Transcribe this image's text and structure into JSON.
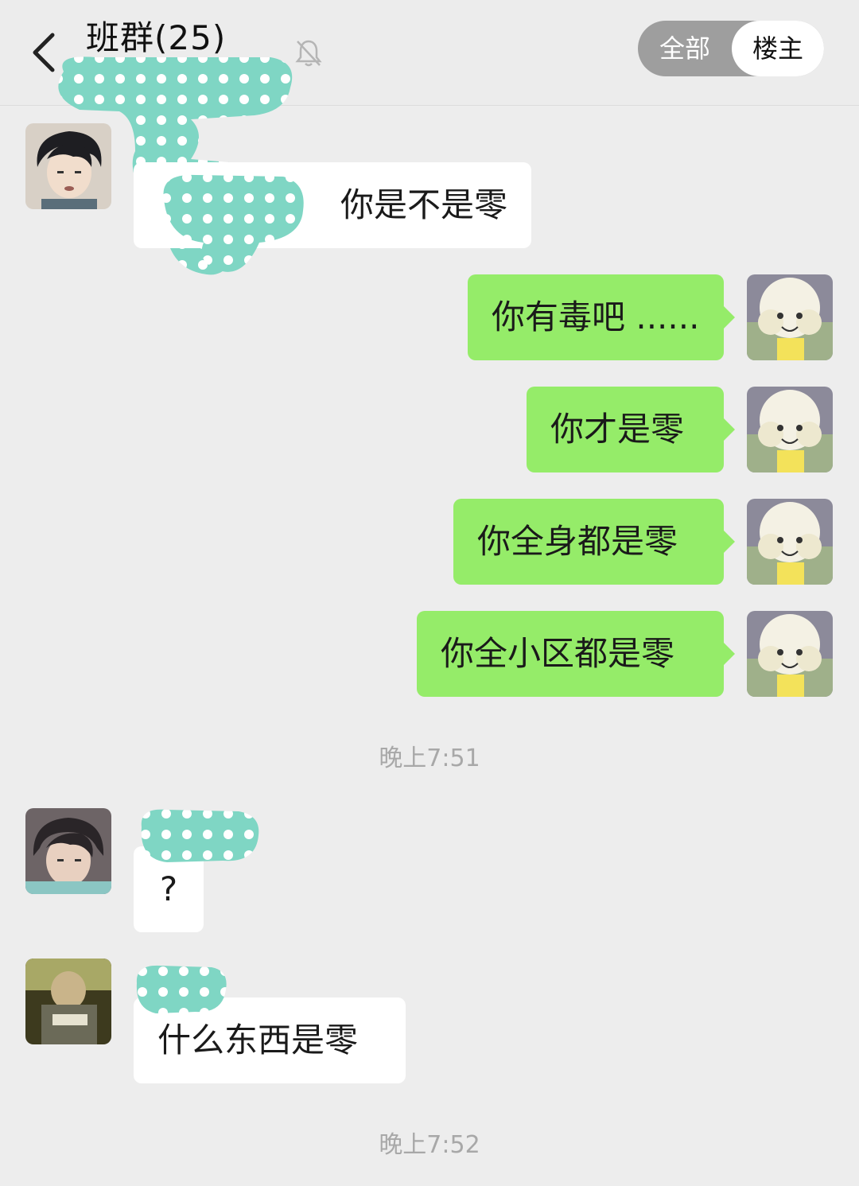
{
  "header": {
    "title": "班群(25)",
    "toggle": {
      "all_label": "全部",
      "host_label": "楼主",
      "selected": "楼主"
    }
  },
  "messages": [
    {
      "side": "left",
      "text": "你是不是零",
      "avatar": "anime-boy-avatar"
    },
    {
      "side": "right",
      "text": "你有毒吧 ......",
      "avatar": "sheep-avatar"
    },
    {
      "side": "right",
      "text": "你才是零",
      "avatar": "sheep-avatar"
    },
    {
      "side": "right",
      "text": "你全身都是零",
      "avatar": "sheep-avatar"
    },
    {
      "side": "right",
      "text": "你全小区都是零",
      "avatar": "sheep-avatar"
    },
    {
      "side": "left",
      "text": "?",
      "avatar": "anime-boy-avatar-2"
    },
    {
      "side": "left",
      "text": "什么东西是零",
      "avatar": "photo-avatar"
    }
  ],
  "timestamps": [
    "晚上7:51",
    "晚上7:52"
  ],
  "colors": {
    "background": "#ededed",
    "bubble_green": "#95ec69",
    "bubble_white": "#ffffff",
    "censor": "#7fd6c4"
  },
  "icons": {
    "back": "chevron-left-icon",
    "mute": "bell-off-icon"
  }
}
